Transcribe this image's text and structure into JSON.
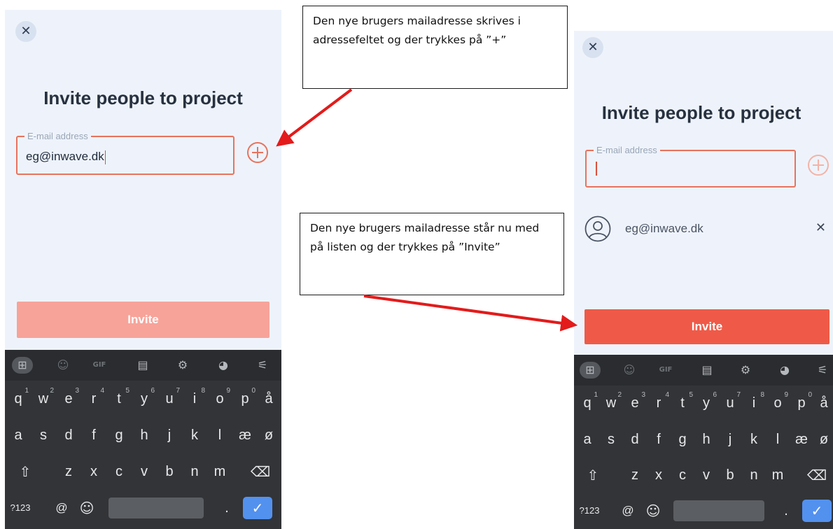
{
  "left_screen": {
    "title": "Invite people to project",
    "email_field": {
      "label": "E-mail address",
      "value": "eg@inwave.dk"
    },
    "invite_label": "Invite"
  },
  "right_screen": {
    "title": "Invite people to project",
    "email_field": {
      "label": "E-mail address",
      "value": ""
    },
    "entries": [
      {
        "email": "eg@inwave.dk"
      }
    ],
    "invite_label": "Invite"
  },
  "keyboard": {
    "toolbar_gif": "GIF",
    "row1": [
      {
        "key": "q",
        "hint": "1"
      },
      {
        "key": "w",
        "hint": "2"
      },
      {
        "key": "e",
        "hint": "3"
      },
      {
        "key": "r",
        "hint": "4"
      },
      {
        "key": "t",
        "hint": "5"
      },
      {
        "key": "y",
        "hint": "6"
      },
      {
        "key": "u",
        "hint": "7"
      },
      {
        "key": "i",
        "hint": "8"
      },
      {
        "key": "o",
        "hint": "9"
      },
      {
        "key": "p",
        "hint": "0"
      },
      {
        "key": "å",
        "hint": ""
      }
    ],
    "row2": [
      "a",
      "s",
      "d",
      "f",
      "g",
      "h",
      "j",
      "k",
      "l",
      "æ",
      "ø"
    ],
    "row3": [
      "z",
      "x",
      "c",
      "v",
      "b",
      "n",
      "m"
    ],
    "symbols_label": "?123",
    "at_label": "@",
    "period_label": "."
  },
  "callouts": [
    {
      "text": "Den nye brugers mailadresse skrives i adressefeltet og der trykkes på ”+”"
    },
    {
      "text": "Den nye brugers mailadresse står nu med på listen og der trykkes på ”Invite”"
    }
  ],
  "colors": {
    "accent": "#ef5a48",
    "accent_disabled": "#f7a39a",
    "arrow": "#e31b1b",
    "keyboard_bg": "#323437",
    "enter_key": "#5391ef"
  }
}
